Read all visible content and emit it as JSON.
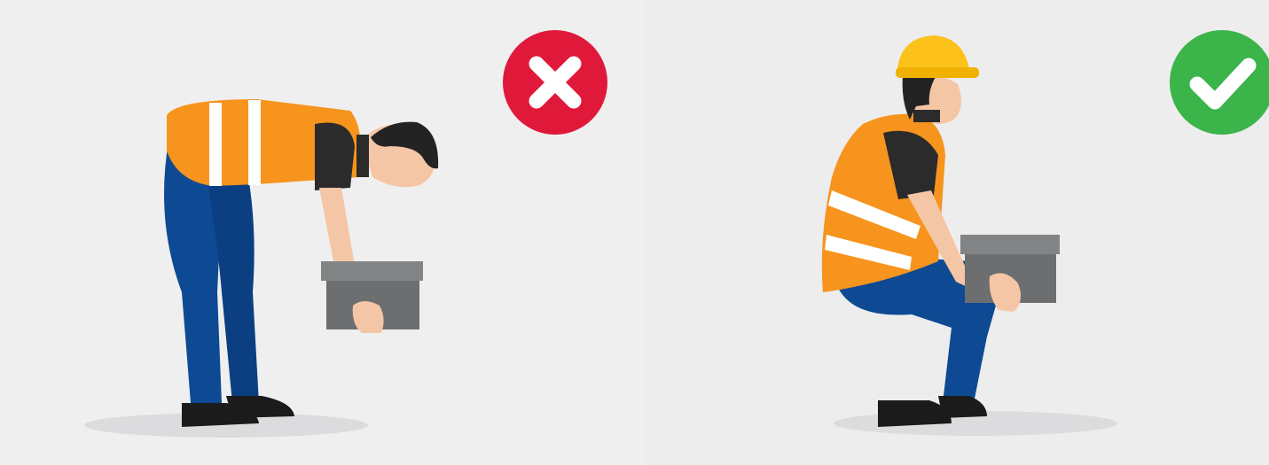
{
  "scene": {
    "panels": [
      {
        "id": "wrong",
        "badge_icon": "x-icon",
        "posture": "bending-at-waist",
        "verdict": "incorrect"
      },
      {
        "id": "right",
        "badge_icon": "check-icon",
        "posture": "squatting-with-straight-back",
        "verdict": "correct"
      }
    ]
  },
  "colors": {
    "background_left": "#efeff0",
    "background_right": "#ededee",
    "wrong_badge": "#e0193a",
    "right_badge": "#3bb44a",
    "vest": "#f7941d",
    "vest_stripe": "#ffffff",
    "pants": "#0e4a94",
    "shirt": "#2b2b2b",
    "skin": "#f5c6a5",
    "hair": "#232323",
    "box": "#6d6e70",
    "box_lid": "#838486",
    "shoe": "#1b1b1b",
    "helmet": "#fcc21b",
    "shadow": "#dcdcde"
  }
}
